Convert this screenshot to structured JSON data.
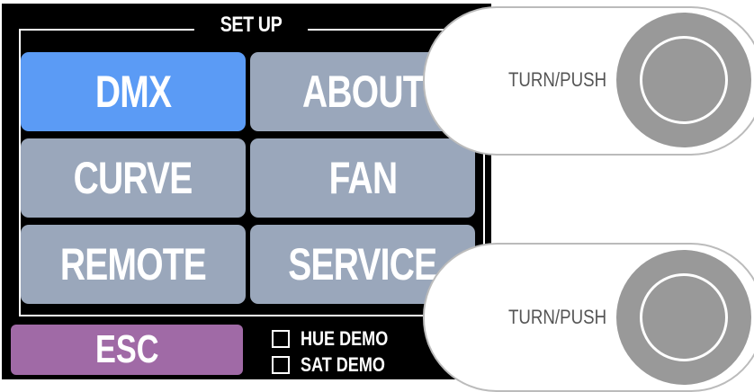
{
  "setup": {
    "title": "SET UP",
    "buttons": [
      {
        "label": "DMX",
        "active": true
      },
      {
        "label": "ABOUT",
        "active": false
      },
      {
        "label": "CURVE",
        "active": false
      },
      {
        "label": "FAN",
        "active": false
      },
      {
        "label": "REMOTE",
        "active": false
      },
      {
        "label": "SERVICE",
        "active": false
      }
    ],
    "esc_label": "ESC",
    "hue_demo": {
      "label": "HUE DEMO",
      "checked": false
    },
    "sat_demo": {
      "label": "SAT DEMO",
      "checked": false
    }
  },
  "knobs": [
    {
      "label": "TURN/PUSH"
    },
    {
      "label": "TURN/PUSH"
    }
  ],
  "colors": {
    "active_button": "#5b9bf5",
    "inactive_button": "#9aa7bb",
    "esc_button": "#a06aa6",
    "knob": "#999999"
  }
}
